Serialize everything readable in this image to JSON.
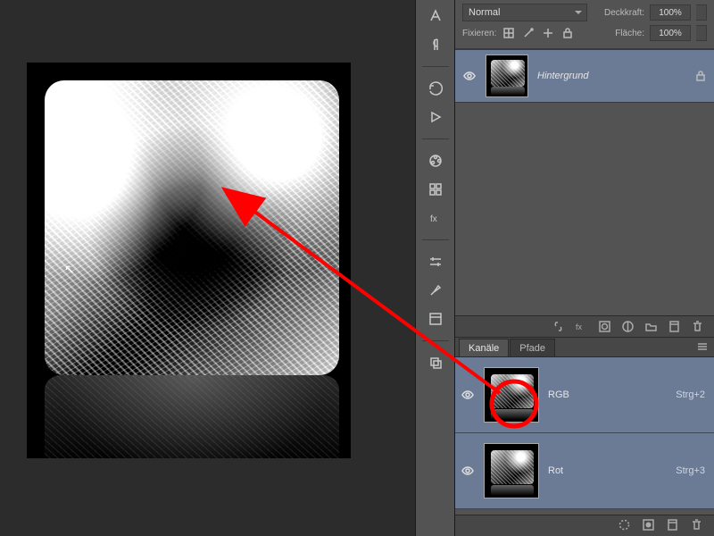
{
  "layers_panel": {
    "blend_mode": "Normal",
    "opacity_label": "Deckkraft:",
    "opacity_value": "100%",
    "lock_label": "Fixieren:",
    "fill_label": "Fläche:",
    "fill_value": "100%",
    "layers": [
      {
        "name": "Hintergrund",
        "locked": true,
        "visible": true
      }
    ]
  },
  "channels_panel": {
    "tab_channels": "Kanäle",
    "tab_paths": "Pfade",
    "channels": [
      {
        "name": "RGB",
        "shortcut": "Strg+2",
        "visible": true
      },
      {
        "name": "Rot",
        "shortcut": "Strg+3",
        "visible": true
      }
    ]
  },
  "chart_data": null
}
